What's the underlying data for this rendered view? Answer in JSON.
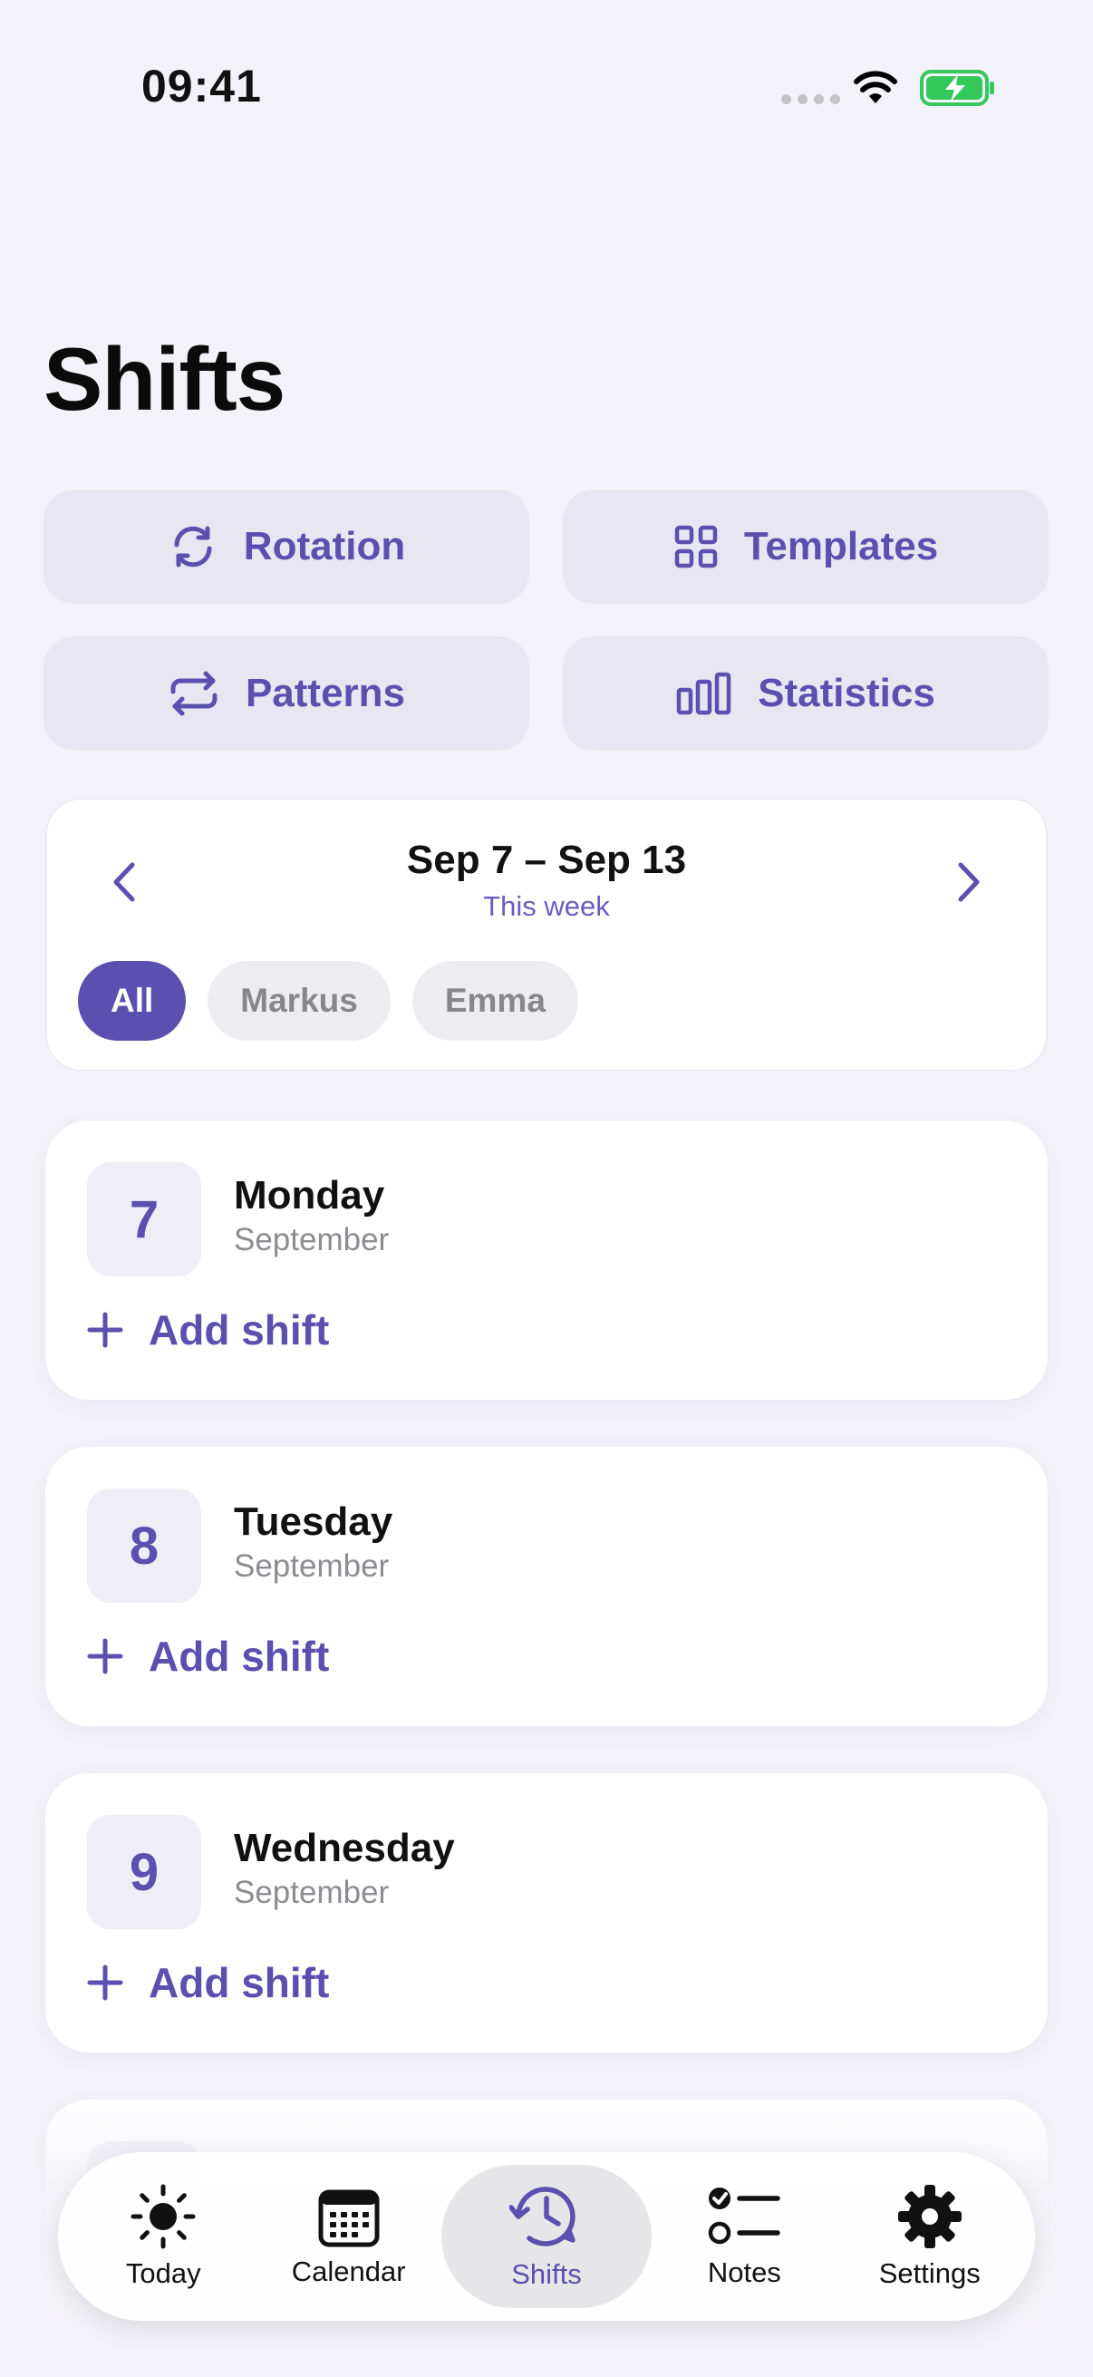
{
  "status": {
    "time": "09:41"
  },
  "page": {
    "title": "Shifts"
  },
  "quick_actions": {
    "rotation": "Rotation",
    "templates": "Templates",
    "patterns": "Patterns",
    "statistics": "Statistics"
  },
  "week": {
    "range": "Sep 7 – Sep 13",
    "subtitle": "This week",
    "filters": [
      "All",
      "Markus",
      "Emma"
    ],
    "selected_filter": "All"
  },
  "days": [
    {
      "number": "7",
      "weekday": "Monday",
      "month": "September",
      "add_label": "Add shift"
    },
    {
      "number": "8",
      "weekday": "Tuesday",
      "month": "September",
      "add_label": "Add shift"
    },
    {
      "number": "9",
      "weekday": "Wednesday",
      "month": "September",
      "add_label": "Add shift"
    }
  ],
  "tabbar": {
    "items": [
      {
        "label": "Today",
        "icon": "sun-icon"
      },
      {
        "label": "Calendar",
        "icon": "calendar-icon"
      },
      {
        "label": "Shifts",
        "icon": "clock-rotate-icon"
      },
      {
        "label": "Notes",
        "icon": "checklist-icon"
      },
      {
        "label": "Settings",
        "icon": "gear-icon"
      }
    ],
    "active": "Shifts"
  },
  "colors": {
    "accent": "#5b4fb0",
    "background": "#f3f2f8",
    "battery": "#34c759"
  }
}
